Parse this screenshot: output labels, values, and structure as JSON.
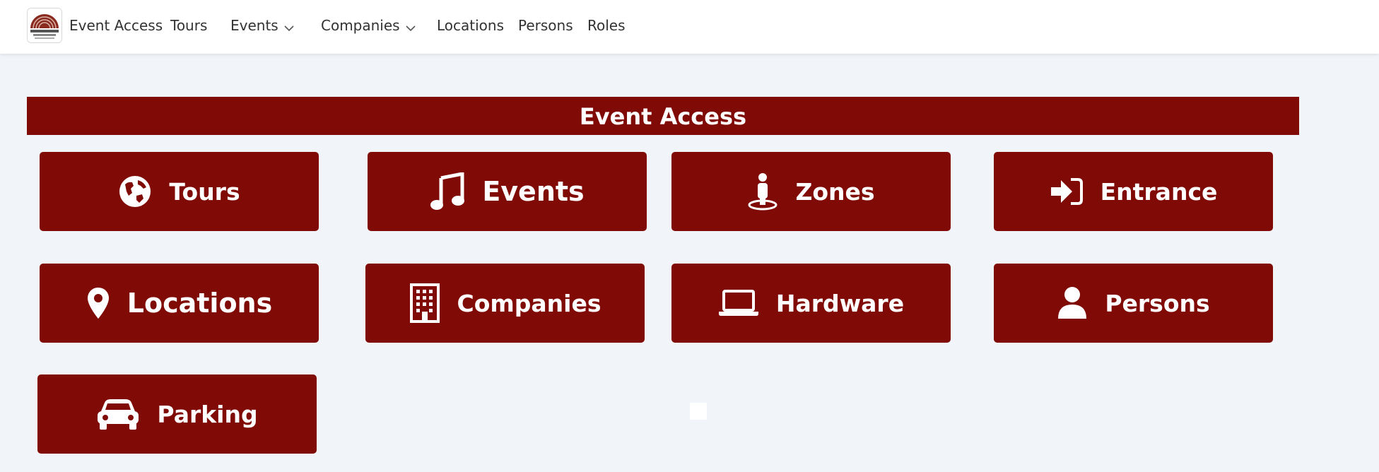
{
  "nav": {
    "brand": "Event Access",
    "items": [
      {
        "label": "Tours"
      },
      {
        "label": "Events"
      },
      {
        "label": "Companies"
      },
      {
        "label": "Locations"
      },
      {
        "label": "Persons"
      },
      {
        "label": "Roles"
      }
    ],
    "logo_icon": "event-access-logo"
  },
  "banner": {
    "title": "Event Access"
  },
  "tiles": [
    {
      "label": "Tours",
      "icon": "globe-icon"
    },
    {
      "label": "Events",
      "icon": "music-note-icon"
    },
    {
      "label": "Zones",
      "icon": "person-pin-icon"
    },
    {
      "label": "Entrance",
      "icon": "sign-in-icon"
    },
    {
      "label": "Locations",
      "icon": "map-marker-icon"
    },
    {
      "label": "Companies",
      "icon": "building-icon"
    },
    {
      "label": "Hardware",
      "icon": "laptop-icon"
    },
    {
      "label": "Persons",
      "icon": "user-icon"
    },
    {
      "label": "Parking",
      "icon": "car-icon"
    }
  ],
  "colors": {
    "accent": "#800a05",
    "background": "#f1f4f8",
    "topbar": "#ffffff"
  }
}
